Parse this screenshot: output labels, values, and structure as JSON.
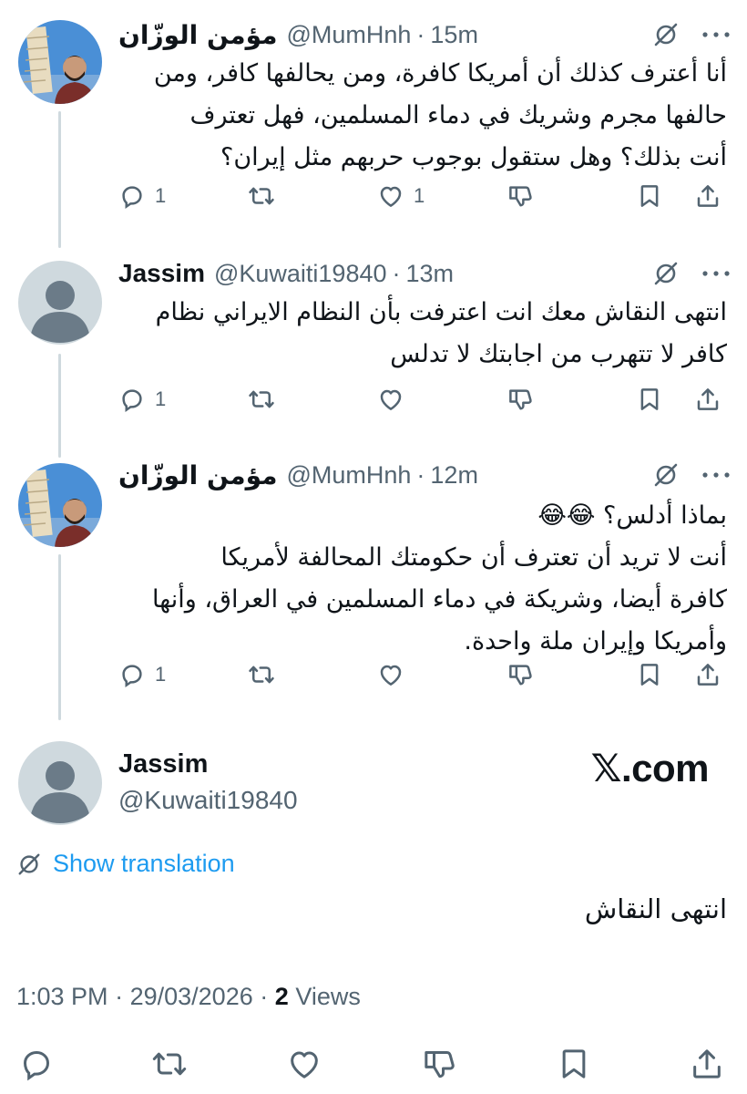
{
  "tweets": [
    {
      "display_name": "مؤمن الوزّان",
      "handle": "@MumHnh",
      "time": "15m",
      "text": "أنا أعترف كذلك أن أمريكا كافرة، ومن يحالفها كافر، ومن\nحالفها مجرم وشريك في دماء المسلمين، فهل تعترف\nأنت بذلك؟ وهل ستقول بوجوب حربهم مثل إيران؟",
      "replies": "1",
      "likes": "1"
    },
    {
      "display_name": "Jassim",
      "handle": "@Kuwaiti19840",
      "time": "13m",
      "text": "انتهى النقاش معك انت اعترفت بأن النظام الايراني نظام\nكافر لا تتهرب من اجابتك لا تدلس",
      "replies": "1",
      "likes": ""
    },
    {
      "display_name": "مؤمن الوزّان",
      "handle": "@MumHnh",
      "time": "12m",
      "text": "بماذا أدلس؟ 😂😂\nأنت لا تريد أن تعترف أن حكومتك المحالفة لأمريكا\nكافرة أيضا، وشريكة في دماء المسلمين في العراق، وأنها\nوأمريكا وإيران ملة واحدة.",
      "replies": "1",
      "likes": ""
    }
  ],
  "main_tweet": {
    "display_name": "Jassim",
    "handle": "@Kuwaiti19840",
    "watermark": "𝕏.com",
    "show_translation": "Show translation",
    "text": "انتهى النقاش",
    "time": "1:03 PM",
    "date": "29/03/2026",
    "views_count": "2",
    "views_label": "Views"
  },
  "separator": "·",
  "colors": {
    "text": "#0f1419",
    "secondary": "#536471",
    "link": "#1d9bf0",
    "thread_line": "#cfd9de"
  },
  "icons": [
    "grok-icon",
    "more-icon",
    "reply-icon",
    "retweet-icon",
    "like-icon",
    "dislike-icon",
    "bookmark-icon",
    "share-icon",
    "translate-icon"
  ]
}
